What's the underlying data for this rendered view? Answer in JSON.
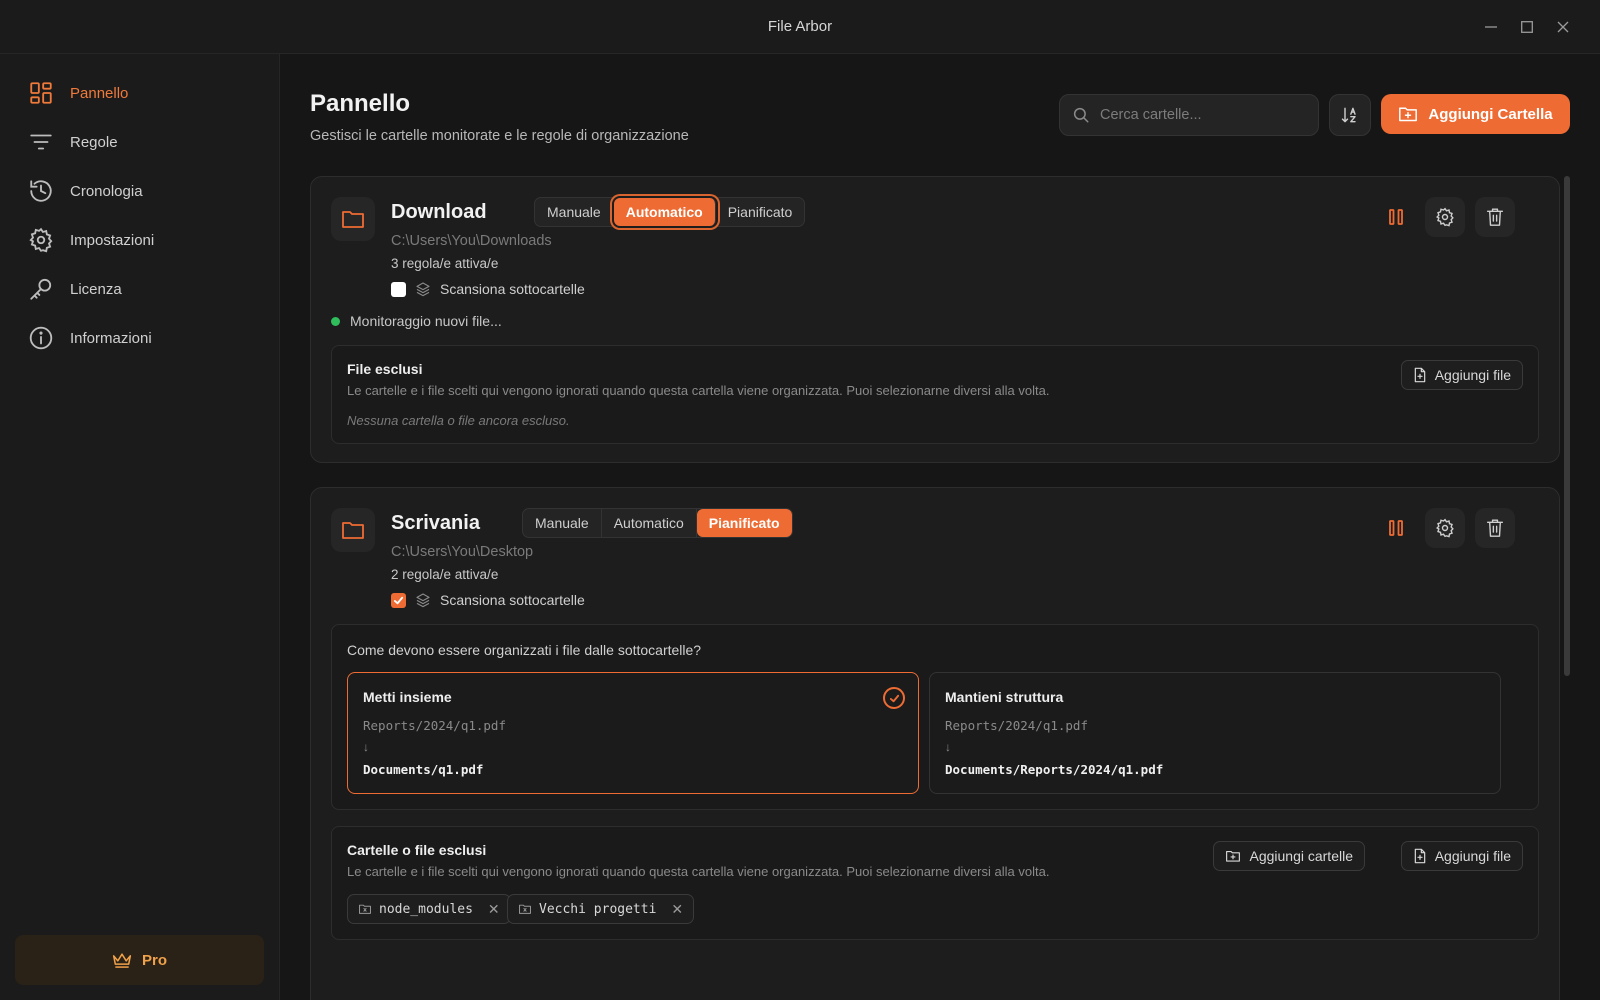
{
  "window": {
    "title": "File Arbor"
  },
  "sidebar": {
    "items": [
      {
        "label": "Pannello",
        "icon": "dashboard-icon",
        "active": true
      },
      {
        "label": "Regole",
        "icon": "filter-icon"
      },
      {
        "label": "Cronologia",
        "icon": "history-icon"
      },
      {
        "label": "Impostazioni",
        "icon": "gear-icon"
      },
      {
        "label": "Licenza",
        "icon": "key-icon"
      },
      {
        "label": "Informazioni",
        "icon": "info-icon"
      }
    ],
    "pro_label": "Pro"
  },
  "header": {
    "title": "Pannello",
    "subtitle": "Gestisci le cartelle monitorate e le regole di organizzazione",
    "search_placeholder": "Cerca cartelle...",
    "add_folder_label": "Aggiungi Cartella"
  },
  "modes": [
    "Manuale",
    "Automatico",
    "Pianificato"
  ],
  "folders": [
    {
      "name": "Download",
      "path": "C:\\Users\\You\\Downloads",
      "rules": "3 regola/e attiva/e",
      "scan_label": "Scansiona sottocartelle",
      "scan_checked": false,
      "active_mode": "Automatico",
      "status": "Monitoraggio nuovi file...",
      "excluded": {
        "title": "File esclusi",
        "description": "Le cartelle e i file scelti qui vengono ignorati quando questa cartella viene organizzata. Puoi selezionarne diversi alla volta.",
        "empty": "Nessuna cartella o file ancora escluso.",
        "add_file_label": "Aggiungi file"
      }
    },
    {
      "name": "Scrivania",
      "path": "C:\\Users\\You\\Desktop",
      "rules": "2 regola/e attiva/e",
      "scan_label": "Scansiona sottocartelle",
      "scan_checked": true,
      "active_mode": "Pianificato",
      "organize": {
        "question": "Come devono essere organizzati i file dalle sottocartelle?",
        "options": [
          {
            "title": "Metti insieme",
            "src": "Reports/2024/q1.pdf",
            "arrow": "↓",
            "dst": "Documents/q1.pdf",
            "selected": true
          },
          {
            "title": "Mantieni struttura",
            "src": "Reports/2024/q1.pdf",
            "arrow": "↓",
            "dst": "Documents/Reports/2024/q1.pdf",
            "selected": false
          }
        ]
      },
      "excluded": {
        "title": "Cartelle o file esclusi",
        "description": "Le cartelle e i file scelti qui vengono ignorati quando questa cartella viene organizzata. Puoi selezionarne diversi alla volta.",
        "add_folders_label": "Aggiungi cartelle",
        "add_file_label": "Aggiungi file",
        "items": [
          "node_modules",
          "Vecchi progetti"
        ]
      }
    }
  ],
  "colors": {
    "accent": "#ee6c34",
    "status_ok": "#2fbe5b",
    "pro": "#f0a24a"
  }
}
